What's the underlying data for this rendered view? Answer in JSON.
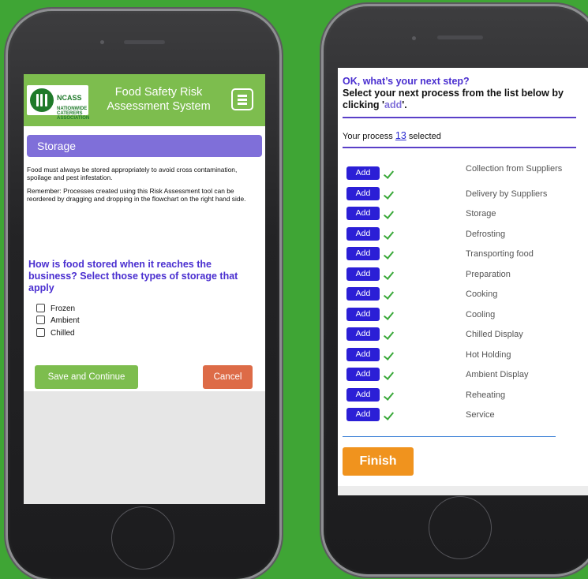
{
  "left_phone": {
    "header": {
      "logo": {
        "big": "NCASS",
        "small": "NATIONWIDE\nCATERERS\nASSOCIATION"
      },
      "title": "Food Safety Risk Assessment System",
      "menu_icon": "hamburger-menu-icon"
    },
    "section_title": "Storage",
    "intro": "Food must always be stored appropriately to avoid cross contamination, spoilage and pest infestation.",
    "reminder": "Remember: Processes created using this Risk Assessment tool can be reordered by dragging and dropping in the flowchart on the right hand side.",
    "question": "How is food stored when it reaches the business? Select those types of storage that apply",
    "options": [
      "Frozen",
      "Ambient",
      "Chilled"
    ],
    "save_label": "Save and Continue",
    "cancel_label": "Cancel"
  },
  "right_phone": {
    "title": "OK, what’s your next step?",
    "instruction_prefix": "Select your next process from the list below by clicking '",
    "instruction_highlight": "add",
    "instruction_suffix": "'.",
    "status_prefix": "Your process",
    "status_number": "13",
    "status_suffix": "selected",
    "add_label": "Add",
    "processes": [
      "Collection from Suppliers",
      "Delivery by Suppliers",
      "Storage",
      "Defrosting",
      "Transporting food",
      "Preparation",
      "Cooking",
      "Cooling",
      "Chilled Display",
      "Hot Holding",
      "Ambient Display",
      "Reheating",
      "Service"
    ],
    "finish_label": "Finish"
  },
  "colors": {
    "background": "#3fa535",
    "header_green": "#7dbd4e",
    "accent_purple": "#7f6fd9",
    "question_purple": "#4a2fd0",
    "add_blue": "#2b1fd6",
    "cancel_orange": "#dd6b47",
    "finish_orange": "#f0931e",
    "tick_green": "#3aa83a"
  }
}
